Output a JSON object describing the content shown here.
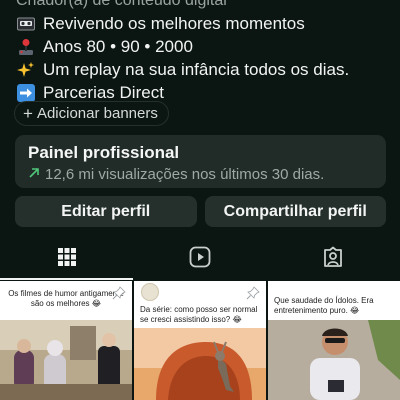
{
  "bio": {
    "category": "Criador(a) de conteúdo digital",
    "lines": [
      {
        "icon": "vhs-tape-icon",
        "text": "Revivendo os melhores momentos"
      },
      {
        "icon": "joystick-icon",
        "text": "Anos 80 • 90 • 2000"
      },
      {
        "icon": "sparkles-icon",
        "text": "Um replay na sua infância todos os dias."
      },
      {
        "icon": "right-arrow-icon",
        "text": "Parcerias Direct"
      }
    ]
  },
  "banners": {
    "label": "Adicionar banners"
  },
  "panel": {
    "title": "Painel profissional",
    "subtitle": "12,6 mi visualizações nos últimos 30 dias."
  },
  "actions": {
    "edit_label": "Editar perfil",
    "share_label": "Compartilhar perfil"
  },
  "tabs": [
    {
      "name": "grid",
      "icon": "grid-icon",
      "active": true
    },
    {
      "name": "reels",
      "icon": "reels-icon",
      "active": false
    },
    {
      "name": "tagged",
      "icon": "tagged-icon",
      "active": false
    }
  ],
  "posts": [
    {
      "caption": "Os filmes de humor antigamente são os melhores 😂",
      "pinned": true
    },
    {
      "caption": "Da série: como posso ser normal se cresci assistindo isso? 😂",
      "pinned": true
    },
    {
      "caption": "Que saudade do Ídolos. Era entretenimento puro. 😂",
      "pinned": true
    }
  ],
  "colors": {
    "background": "#0b1512",
    "card": "#212b28",
    "button": "#25302c",
    "trend_green": "#4fc67a"
  }
}
